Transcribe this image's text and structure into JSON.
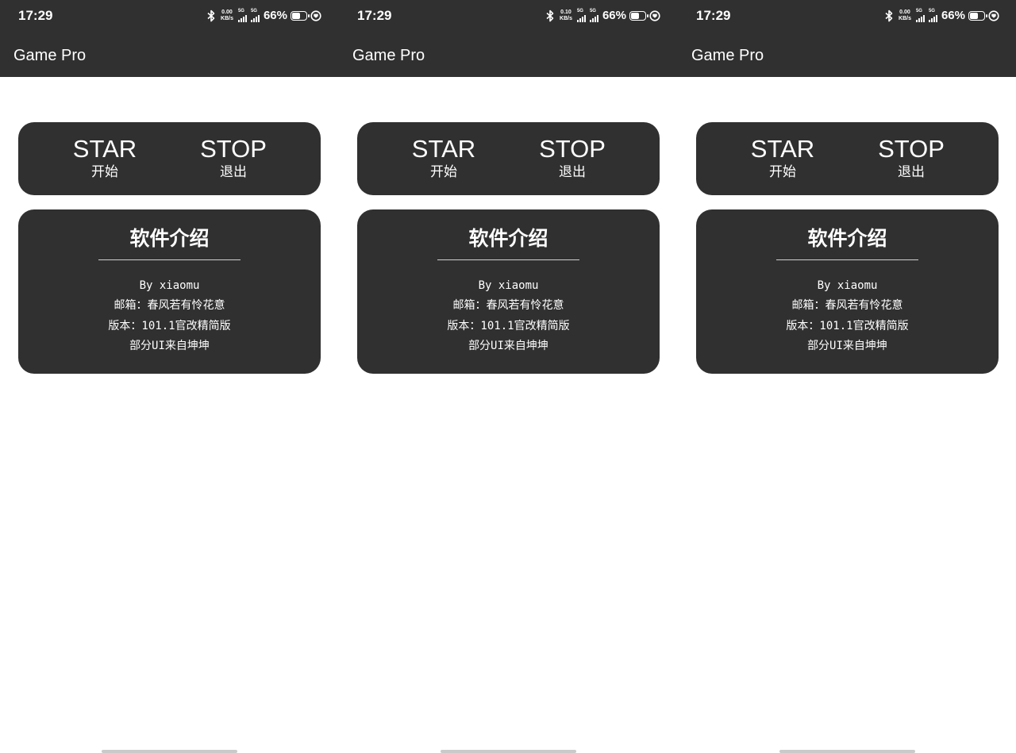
{
  "screens": [
    {
      "status": {
        "time": "17:29",
        "speed_value": "0.00",
        "speed_unit": "KB/s",
        "sim1": "5G",
        "sim2": "5G",
        "battery": "66%",
        "battery_level": 0.66
      },
      "app_title": "Game Pro",
      "controls": {
        "start_label": "STAR",
        "start_sub": "开始",
        "stop_label": "STOP",
        "stop_sub": "退出"
      },
      "info": {
        "title": "软件介绍",
        "lines": [
          "By xiaomu",
          "邮箱：春风若有怜花意",
          "版本：101.1官改精简版",
          "部分UI来自坤坤"
        ]
      }
    },
    {
      "status": {
        "time": "17:29",
        "speed_value": "0.10",
        "speed_unit": "KB/s",
        "sim1": "5G",
        "sim2": "5G",
        "battery": "66%",
        "battery_level": 0.66
      },
      "app_title": "Game Pro",
      "controls": {
        "start_label": "STAR",
        "start_sub": "开始",
        "stop_label": "STOP",
        "stop_sub": "退出"
      },
      "info": {
        "title": "软件介绍",
        "lines": [
          "By xiaomu",
          "邮箱：春风若有怜花意",
          "版本：101.1官改精简版",
          "部分UI来自坤坤"
        ]
      }
    },
    {
      "status": {
        "time": "17:29",
        "speed_value": "0.00",
        "speed_unit": "KB/s",
        "sim1": "5G",
        "sim2": "5G",
        "battery": "66%",
        "battery_level": 0.66
      },
      "app_title": "Game Pro",
      "controls": {
        "start_label": "STAR",
        "start_sub": "开始",
        "stop_label": "STOP",
        "stop_sub": "退出"
      },
      "info": {
        "title": "软件介绍",
        "lines": [
          "By xiaomu",
          "邮箱：春风若有怜花意",
          "版本：101.1官改精简版",
          "部分UI来自坤坤"
        ]
      }
    }
  ],
  "colors": {
    "appbar": "#303030",
    "card": "#303030",
    "text_on_dark": "#ffffff",
    "background": "#ffffff"
  },
  "icons": [
    "bluetooth-icon",
    "signal-icon",
    "battery-icon",
    "charging-icon"
  ]
}
